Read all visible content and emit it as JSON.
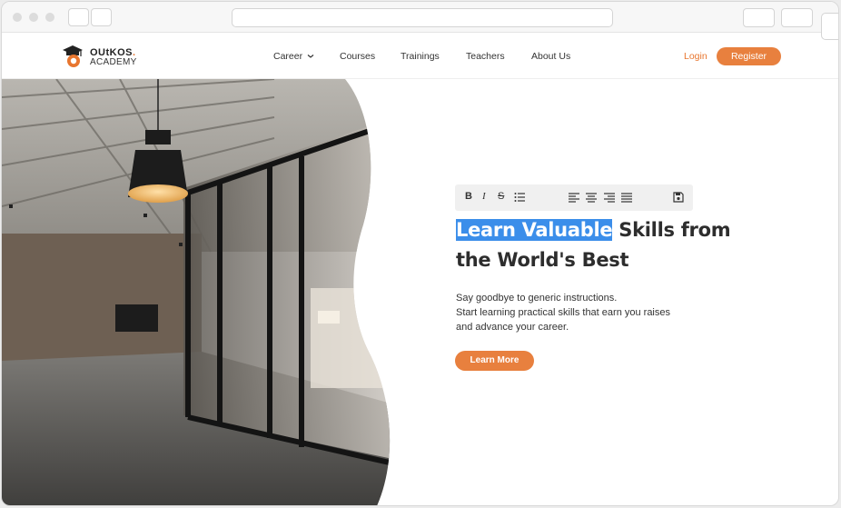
{
  "header": {
    "logo_word1": "OUtKOS",
    "logo_dot": ".",
    "logo_word2": "ACADEMY",
    "menu": [
      "Career",
      "Courses",
      "Trainings",
      "Teachers",
      "About Us"
    ],
    "login": "Login",
    "register": "Register"
  },
  "editor_toolbar": {
    "buttons": [
      "bold-icon",
      "italic-icon",
      "strikethrough-icon",
      "bulleted-list-icon",
      "align-left-icon",
      "align-center-icon",
      "align-right-icon",
      "justify-icon",
      "save-icon"
    ],
    "bold_label": "B",
    "italic_label": "I",
    "strike_label": "S"
  },
  "hero": {
    "headline_selected": "Learn Valuable",
    "headline_rest": " Skills from the World's Best",
    "desc_line1": "Say goodbye to generic instructions.",
    "desc_line2": "Start learning practical skills that earn you raises",
    "desc_line3": "and advance your career.",
    "cta": "Learn More"
  },
  "colors": {
    "accent": "#e8803e",
    "selection": "#3b8eea"
  }
}
